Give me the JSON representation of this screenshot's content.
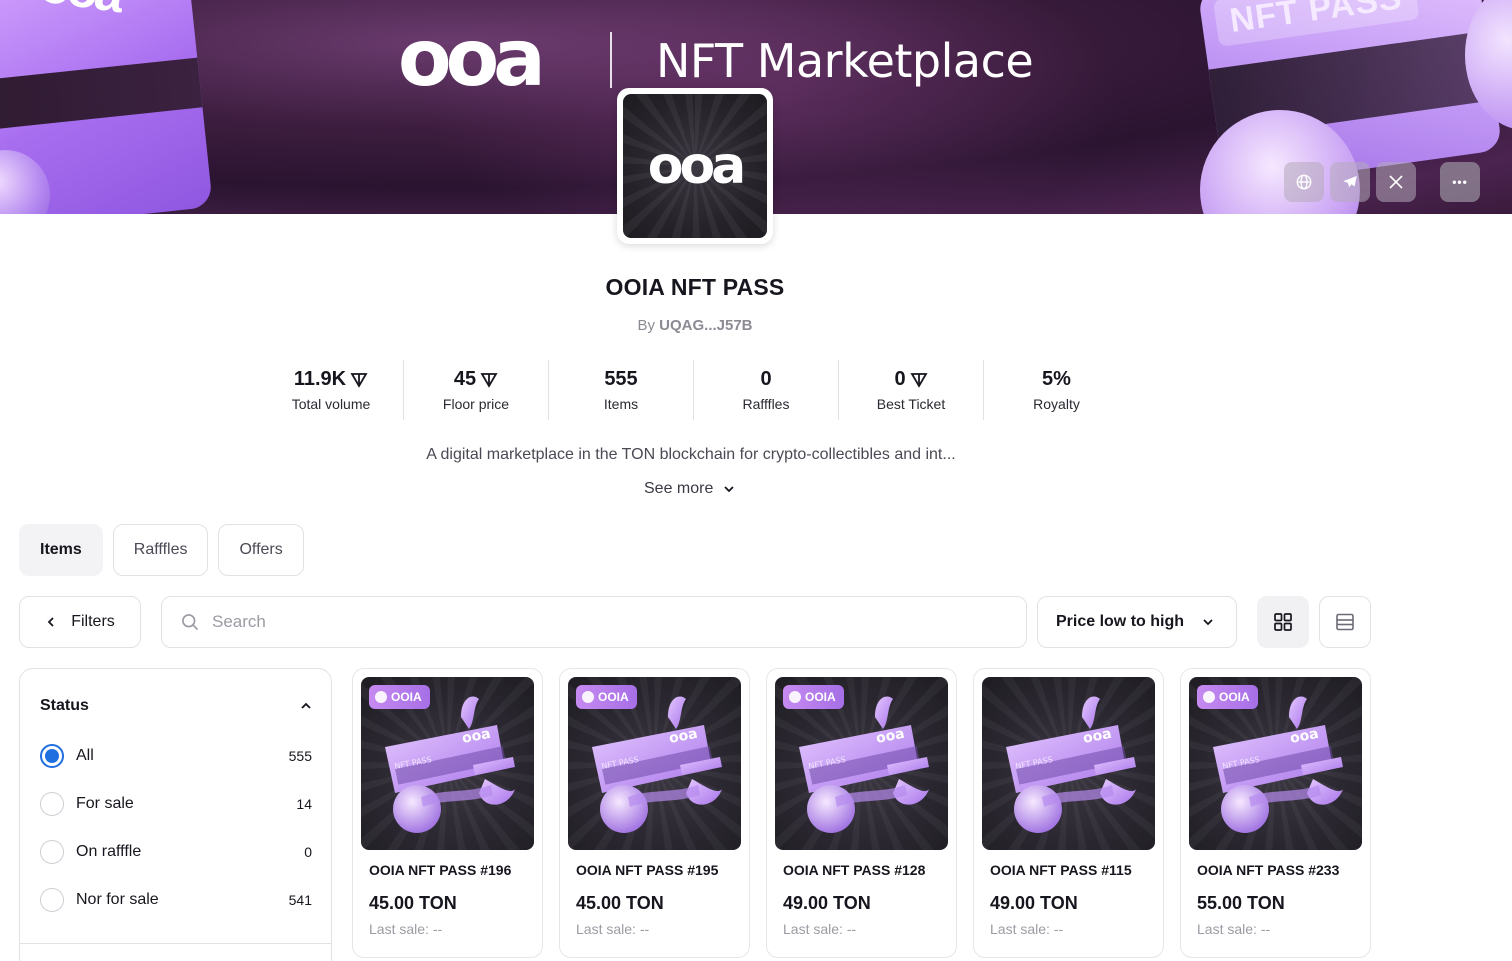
{
  "banner": {
    "brand_logo": "ooa",
    "brand_title": "NFT Marketplace",
    "card_tag": "NFT PASS",
    "card_logo": "ooa"
  },
  "social": [
    "globe-icon",
    "telegram-icon",
    "x-icon"
  ],
  "more_label": "•••",
  "collection": {
    "avatar_text": "ooa",
    "title": "OOIA NFT PASS",
    "by_prefix": "By",
    "owner": "UQAG...J57B",
    "description": "A digital marketplace in the TON blockchain for crypto-collectibles and int...",
    "see_more": "See more"
  },
  "stats": [
    {
      "value": "11.9K",
      "label": "Total volume",
      "ton": true
    },
    {
      "value": "45",
      "label": "Floor price",
      "ton": true
    },
    {
      "value": "555",
      "label": "Items",
      "ton": false
    },
    {
      "value": "0",
      "label": "Rafffles",
      "ton": false
    },
    {
      "value": "0",
      "label": "Best Ticket",
      "ton": true
    },
    {
      "value": "5%",
      "label": "Royalty",
      "ton": false
    }
  ],
  "tabs": [
    {
      "label": "Items",
      "active": true
    },
    {
      "label": "Rafffles",
      "active": false
    },
    {
      "label": "Offers",
      "active": false
    }
  ],
  "toolbar": {
    "filters_label": "Filters",
    "search_placeholder": "Search",
    "sort_label": "Price low to high"
  },
  "filter_panel": {
    "heading": "Status",
    "options": [
      {
        "label": "All",
        "count": "555",
        "selected": true
      },
      {
        "label": "For sale",
        "count": "14",
        "selected": false
      },
      {
        "label": "On rafffle",
        "count": "0",
        "selected": false
      },
      {
        "label": "Nor for sale",
        "count": "541",
        "selected": false
      }
    ]
  },
  "items": [
    {
      "name": "OOIA NFT PASS #196",
      "price": "45.00 TON",
      "last_sale": "Last sale: --",
      "badge": "OOIA"
    },
    {
      "name": "OOIA NFT PASS #195",
      "price": "45.00 TON",
      "last_sale": "Last sale: --",
      "badge": "OOIA"
    },
    {
      "name": "OOIA NFT PASS #128",
      "price": "49.00 TON",
      "last_sale": "Last sale: --",
      "badge": "OOIA"
    },
    {
      "name": "OOIA NFT PASS #115",
      "price": "49.00 TON",
      "last_sale": "Last sale: --",
      "badge": ""
    },
    {
      "name": "OOIA NFT PASS #233",
      "price": "55.00 TON",
      "last_sale": "Last sale: --",
      "badge": "OOIA"
    }
  ],
  "colors": {
    "accent_radio": "#1f6fe0",
    "badge": "#b57ceb",
    "banner_bg": "#3d1d3f"
  }
}
